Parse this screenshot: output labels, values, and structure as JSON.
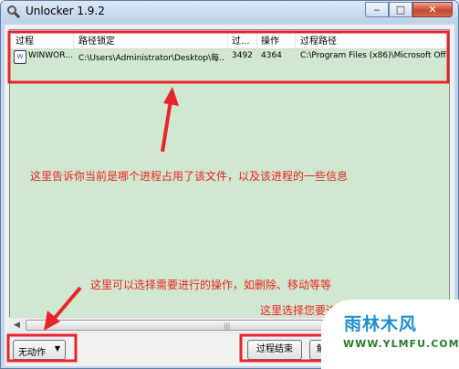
{
  "window": {
    "title": "Unlocker 1.9.2",
    "buttons": {
      "minimize": "‒",
      "maximize": "□",
      "close": "✕"
    }
  },
  "list": {
    "columns": [
      "过程",
      "路径锁定",
      "过...",
      "操作",
      "过程路径"
    ],
    "rows": [
      {
        "process": "WINWOR...",
        "path": "C:\\Users\\Administrator\\Desktop\\每...",
        "pid": "3492",
        "handle": "4364",
        "process_path": "C:\\Program Files (x86)\\Microsoft Off..."
      }
    ],
    "process_icon": "W"
  },
  "annotations": {
    "top": "这里告诉你当前是哪个进程占用了该文件，以及该进程的一些信息",
    "left": "这里可以选择需要进行的操作，如删除、移动等等",
    "right": "这里选择您要进行的附加操作"
  },
  "bottom": {
    "action_dropdown": "无动作",
    "kill_process_button": "过程结束",
    "unlock_button": "解锁"
  },
  "watermark": {
    "title": "雨林木风",
    "url": "WWW.YLMFU.COM"
  },
  "colors": {
    "list_background": "#cfe8cf",
    "annotation": "#e8242c",
    "title_bar": "#bcd1ea"
  }
}
